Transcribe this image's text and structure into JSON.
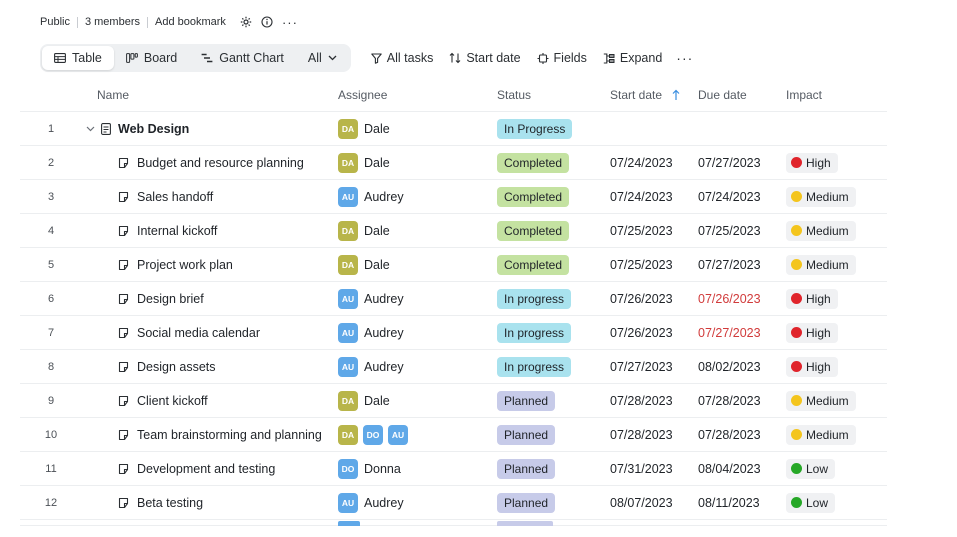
{
  "meta": {
    "visibility": "Public",
    "members": "3 members",
    "bookmark": "Add bookmark"
  },
  "views": [
    {
      "label": "Table",
      "active": true
    },
    {
      "label": "Board",
      "active": false
    },
    {
      "label": "Gantt Chart",
      "active": false
    },
    {
      "label": "All",
      "active": false
    }
  ],
  "tools": {
    "filter": "All tasks",
    "sort": "Start date",
    "fields": "Fields",
    "expand": "Expand",
    "more": "···"
  },
  "columns": {
    "name": "Name",
    "assignee": "Assignee",
    "status": "Status",
    "start": "Start date",
    "due": "Due date",
    "impact": "Impact"
  },
  "rows": [
    {
      "num": "1",
      "name": "Web Design",
      "parent": true,
      "assignees": [
        {
          "initials": "DA",
          "cls": "da"
        }
      ],
      "assignee_name": "Dale",
      "status": "In Progress",
      "status_cls": "inprogress",
      "start": "",
      "due": "",
      "due_overdue": false,
      "impact": "",
      "impact_cls": ""
    },
    {
      "num": "2",
      "name": "Budget and resource planning",
      "parent": false,
      "assignees": [
        {
          "initials": "DA",
          "cls": "da"
        }
      ],
      "assignee_name": "Dale",
      "status": "Completed",
      "status_cls": "completed",
      "start": "07/24/2023",
      "due": "07/27/2023",
      "due_overdue": false,
      "impact": "High",
      "impact_cls": "high"
    },
    {
      "num": "3",
      "name": "Sales handoff",
      "parent": false,
      "assignees": [
        {
          "initials": "AU",
          "cls": "au"
        }
      ],
      "assignee_name": "Audrey",
      "status": "Completed",
      "status_cls": "completed",
      "start": "07/24/2023",
      "due": "07/24/2023",
      "due_overdue": false,
      "impact": "Medium",
      "impact_cls": "medium"
    },
    {
      "num": "4",
      "name": "Internal kickoff",
      "parent": false,
      "assignees": [
        {
          "initials": "DA",
          "cls": "da"
        }
      ],
      "assignee_name": "Dale",
      "status": "Completed",
      "status_cls": "completed",
      "start": "07/25/2023",
      "due": "07/25/2023",
      "due_overdue": false,
      "impact": "Medium",
      "impact_cls": "medium"
    },
    {
      "num": "5",
      "name": "Project work plan",
      "parent": false,
      "assignees": [
        {
          "initials": "DA",
          "cls": "da"
        }
      ],
      "assignee_name": "Dale",
      "status": "Completed",
      "status_cls": "completed",
      "start": "07/25/2023",
      "due": "07/27/2023",
      "due_overdue": false,
      "impact": "Medium",
      "impact_cls": "medium"
    },
    {
      "num": "6",
      "name": "Design brief",
      "parent": false,
      "assignees": [
        {
          "initials": "AU",
          "cls": "au"
        }
      ],
      "assignee_name": "Audrey",
      "status": "In progress",
      "status_cls": "inprogress",
      "start": "07/26/2023",
      "due": "07/26/2023",
      "due_overdue": true,
      "impact": "High",
      "impact_cls": "high"
    },
    {
      "num": "7",
      "name": "Social media calendar",
      "parent": false,
      "assignees": [
        {
          "initials": "AU",
          "cls": "au"
        }
      ],
      "assignee_name": "Audrey",
      "status": "In progress",
      "status_cls": "inprogress",
      "start": "07/26/2023",
      "due": "07/27/2023",
      "due_overdue": true,
      "impact": "High",
      "impact_cls": "high"
    },
    {
      "num": "8",
      "name": "Design assets",
      "parent": false,
      "assignees": [
        {
          "initials": "AU",
          "cls": "au"
        }
      ],
      "assignee_name": "Audrey",
      "status": "In progress",
      "status_cls": "inprogress",
      "start": "07/27/2023",
      "due": "08/02/2023",
      "due_overdue": false,
      "impact": "High",
      "impact_cls": "high"
    },
    {
      "num": "9",
      "name": "Client kickoff",
      "parent": false,
      "assignees": [
        {
          "initials": "DA",
          "cls": "da"
        }
      ],
      "assignee_name": "Dale",
      "status": "Planned",
      "status_cls": "planned",
      "start": "07/28/2023",
      "due": "07/28/2023",
      "due_overdue": false,
      "impact": "Medium",
      "impact_cls": "medium"
    },
    {
      "num": "10",
      "name": "Team brainstorming and planning",
      "parent": false,
      "assignees": [
        {
          "initials": "DA",
          "cls": "da"
        },
        {
          "initials": "DO",
          "cls": "do"
        },
        {
          "initials": "AU",
          "cls": "au"
        }
      ],
      "assignee_name": "",
      "status": "Planned",
      "status_cls": "planned",
      "start": "07/28/2023",
      "due": "07/28/2023",
      "due_overdue": false,
      "impact": "Medium",
      "impact_cls": "medium"
    },
    {
      "num": "11",
      "name": "Development and testing",
      "parent": false,
      "assignees": [
        {
          "initials": "DO",
          "cls": "do"
        }
      ],
      "assignee_name": "Donna",
      "status": "Planned",
      "status_cls": "planned",
      "start": "07/31/2023",
      "due": "08/04/2023",
      "due_overdue": false,
      "impact": "Low",
      "impact_cls": "low"
    },
    {
      "num": "12",
      "name": "Beta testing",
      "parent": false,
      "assignees": [
        {
          "initials": "AU",
          "cls": "au"
        }
      ],
      "assignee_name": "Audrey",
      "status": "Planned",
      "status_cls": "planned",
      "start": "08/07/2023",
      "due": "08/11/2023",
      "due_overdue": false,
      "impact": "Low",
      "impact_cls": "low"
    }
  ]
}
